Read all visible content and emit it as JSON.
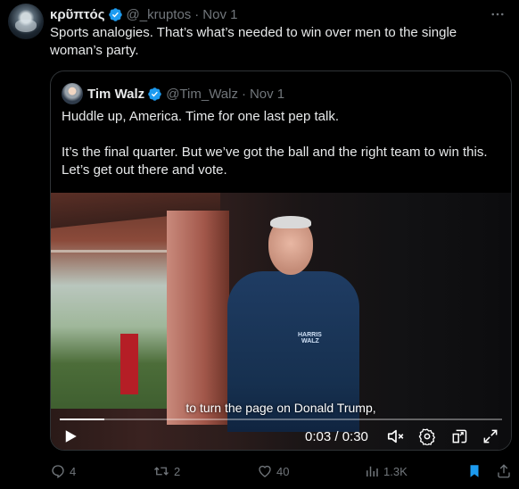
{
  "tweet": {
    "author_name": "κρῦπτός",
    "handle": "@_kruptos",
    "separator": "·",
    "date": "Nov 1",
    "text": "Sports analogies.  That’s what’s needed to win over men to the single woman’s party."
  },
  "quote": {
    "author_name": "Tim Walz",
    "handle": "@Tim_Walz",
    "separator": "·",
    "date": "Nov 1",
    "paragraph_1": "Huddle up, America. Time for one last pep talk.",
    "paragraph_2": "It’s the final quarter. But we’ve got the ball and the right team to win this. Let’s get out there and vote."
  },
  "video": {
    "caption": "to turn the page on Donald Trump,",
    "time": "0:03 / 0:30",
    "progress": 0.1,
    "jacket_logo_line1": "HARRIS",
    "jacket_logo_line2": "WALZ"
  },
  "actions": {
    "replies": "4",
    "reposts": "2",
    "likes": "40",
    "views": "1.3K"
  },
  "colors": {
    "verified": "#1d9bf0",
    "muted": "#71767b",
    "bookmark_active": "#1d9bf0"
  },
  "icons": [
    "verified-icon",
    "more-icon",
    "play-icon",
    "mute-icon",
    "settings-icon",
    "pip-icon",
    "fullscreen-icon",
    "reply-icon",
    "repost-icon",
    "like-icon",
    "views-icon",
    "bookmark-icon",
    "share-icon"
  ]
}
